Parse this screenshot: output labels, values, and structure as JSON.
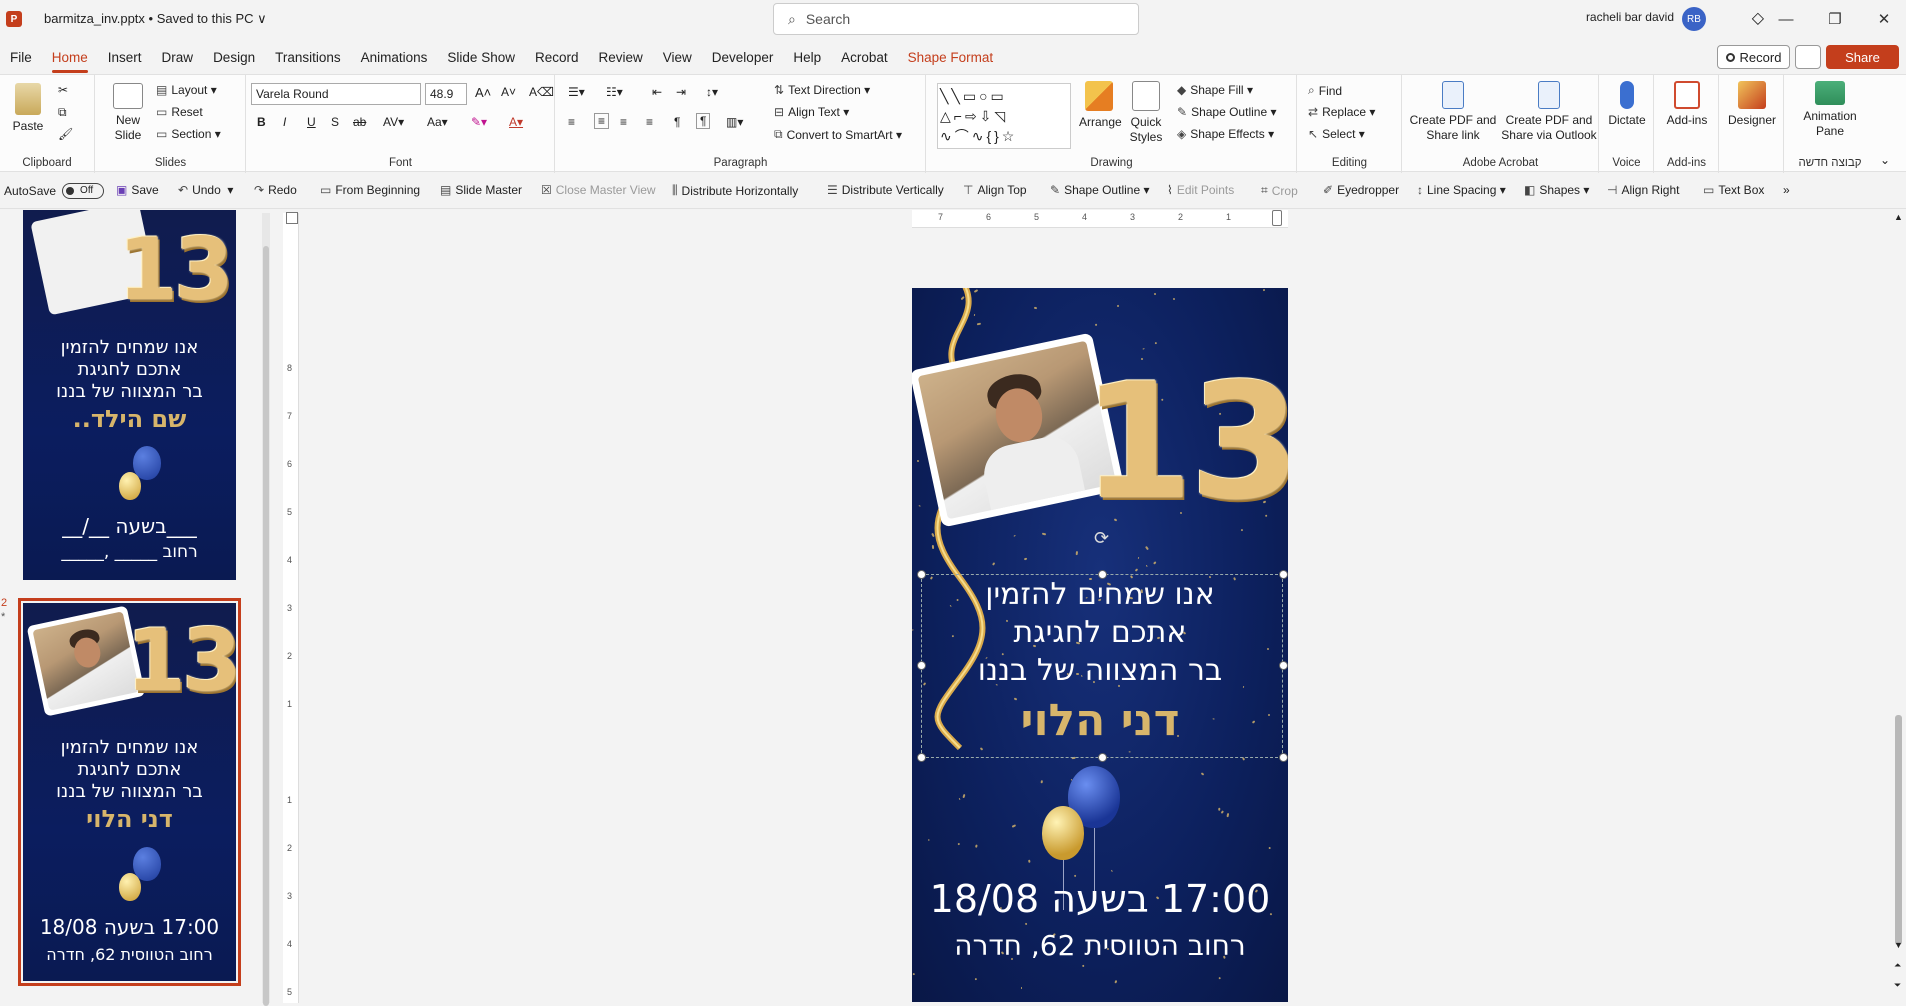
{
  "titlebar": {
    "app_icon_letter": "P",
    "doc_title": "barmitza_inv.pptx • Saved to this PC ∨",
    "search_placeholder": "Search",
    "user_name": "racheli bar david",
    "avatar_initials": "RB"
  },
  "menu": {
    "items": [
      "File",
      "Home",
      "Insert",
      "Draw",
      "Design",
      "Transitions",
      "Animations",
      "Slide Show",
      "Record",
      "Review",
      "View",
      "Developer",
      "Help",
      "Acrobat",
      "Shape Format"
    ],
    "active": "Home",
    "record_label": "Record",
    "share_label": "Share"
  },
  "ribbon": {
    "clipboard": {
      "label": "Clipboard",
      "paste": "Paste"
    },
    "slides": {
      "label": "Slides",
      "new_slide": "New Slide",
      "layout": "Layout",
      "reset": "Reset",
      "section": "Section"
    },
    "font": {
      "label": "Font",
      "family": "Varela Round",
      "size": "48.9"
    },
    "paragraph": {
      "label": "Paragraph",
      "text_direction": "Text Direction",
      "align_text": "Align Text",
      "convert_smartart": "Convert to SmartArt"
    },
    "drawing": {
      "label": "Drawing",
      "arrange": "Arrange",
      "quick_styles": "Quick Styles",
      "shape_fill": "Shape Fill",
      "shape_outline": "Shape Outline",
      "shape_effects": "Shape Effects"
    },
    "editing": {
      "label": "Editing",
      "find": "Find",
      "replace": "Replace",
      "select": "Select"
    },
    "acrobat": {
      "label": "Adobe Acrobat",
      "create_pdf_link": "Create PDF and Share link",
      "create_pdf_outlook": "Create PDF and Share via Outlook"
    },
    "voice": {
      "label": "Voice",
      "dictate": "Dictate"
    },
    "addins": {
      "label": "Add-ins",
      "addins": "Add-ins"
    },
    "designer": {
      "label": "Designer"
    },
    "new_group": {
      "label": "קבוצה חדשה",
      "animation_pane": "Animation Pane"
    }
  },
  "qat": {
    "autosave": "AutoSave",
    "autosave_state": "Off",
    "save": "Save",
    "undo": "Undo",
    "redo": "Redo",
    "from_beginning": "From Beginning",
    "slide_master": "Slide Master",
    "close_master": "Close Master View",
    "distribute_h": "Distribute Horizontally",
    "distribute_v": "Distribute Vertically",
    "align_top": "Align Top",
    "shape_outline": "Shape Outline",
    "edit_points": "Edit Points",
    "crop": "Crop",
    "eyedropper": "Eyedropper",
    "line_spacing": "Line Spacing",
    "shapes": "Shapes",
    "align_right": "Align Right",
    "text_box": "Text Box"
  },
  "slides": [
    {
      "number": "",
      "line1": "אנו שמחים להזמין",
      "line2": "אתכם לחגיגת",
      "line3": "בר המצווה של בננו",
      "name": "שם הילד..",
      "date": "___בשעה  __/__",
      "address": "רחוב _____ ,_____"
    },
    {
      "number": "2",
      "line1": "אנו שמחים להזמין",
      "line2": "אתכם לחגיגת",
      "line3": "בר המצווה של בננו",
      "name": "דני הלוי",
      "date": "17:00 בשעה  18/08",
      "address": "רחוב הטווסית 62, חדרה"
    }
  ],
  "main_slide": {
    "number_text": "13",
    "line1": "אנו שמחים להזמין",
    "line2": "אתכם לחגיגת",
    "line3": "בר המצווה של בננו",
    "name": "דני הלוי",
    "date": "17:00 בשעה  18/08",
    "address": "רחוב הטווסית 62, חדרה"
  },
  "ruler": {
    "h_numbers": [
      "7",
      "6",
      "5",
      "4",
      "3",
      "2",
      "1"
    ],
    "v_numbers": [
      "8",
      "7",
      "6",
      "5",
      "4",
      "3",
      "2",
      "1",
      "1",
      "2",
      "3",
      "4",
      "5"
    ]
  },
  "colors": {
    "accent": "#c43e1c",
    "slide_bg": "#0d215f",
    "gold": "#d7b56b"
  }
}
